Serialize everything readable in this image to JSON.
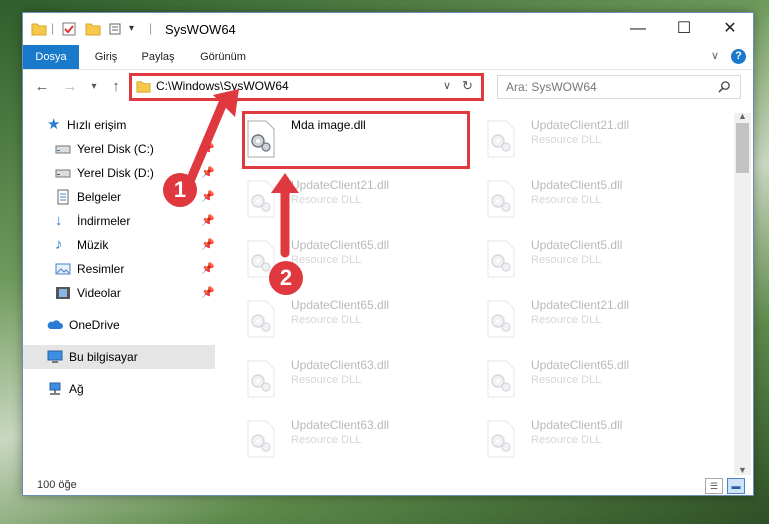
{
  "window": {
    "title": "SysWOW64",
    "minimize": "—",
    "maximize": "☐",
    "close": "✕"
  },
  "ribbon": {
    "tabs": [
      "Dosya",
      "Giriş",
      "Paylaş",
      "Görünüm"
    ]
  },
  "navbar": {
    "address": "C:\\Windows\\SysWOW64",
    "search_placeholder": "Ara: SysWOW64"
  },
  "sidebar": {
    "items": [
      {
        "label": "Hızlı erişim",
        "icon": "star-icon"
      },
      {
        "label": "Yerel Disk (C:)",
        "icon": "drive-icon"
      },
      {
        "label": "Yerel Disk (D:)",
        "icon": "drive-icon"
      },
      {
        "label": "Belgeler",
        "icon": "documents-icon"
      },
      {
        "label": "İndirmeler",
        "icon": "download-icon"
      },
      {
        "label": "Müzik",
        "icon": "music-icon"
      },
      {
        "label": "Resimler",
        "icon": "pictures-icon"
      },
      {
        "label": "Videolar",
        "icon": "videos-icon"
      },
      {
        "label": "OneDrive",
        "icon": "cloud-icon"
      },
      {
        "label": "Bu bilgisayar",
        "icon": "computer-icon"
      },
      {
        "label": "Ağ",
        "icon": "network-icon"
      }
    ]
  },
  "files": [
    {
      "name": "Mda image.dll",
      "type": ""
    },
    {
      "name": "UpdateClient21.dll",
      "type": "Resource DLL"
    },
    {
      "name": "UpdateClient21.dll",
      "type": "Resource DLL"
    },
    {
      "name": "UpdateClient5.dll",
      "type": "Resource DLL"
    },
    {
      "name": "UpdateClient65.dll",
      "type": "Resource DLL"
    },
    {
      "name": "UpdateClient5.dll",
      "type": "Resource DLL"
    },
    {
      "name": "UpdateClient65.dll",
      "type": "Resource DLL"
    },
    {
      "name": "UpdateClient21.dll",
      "type": "Resource DLL"
    },
    {
      "name": "UpdateClient63.dll",
      "type": "Resource DLL"
    },
    {
      "name": "UpdateClient65.dll",
      "type": "Resource DLL"
    },
    {
      "name": "UpdateClient63.dll",
      "type": "Resource DLL"
    },
    {
      "name": "UpdateClient5.dll",
      "type": "Resource DLL"
    }
  ],
  "status": {
    "count": "100 öğe"
  },
  "annotations": {
    "badge1": "1",
    "badge2": "2"
  },
  "colors": {
    "accent": "#1979ca",
    "highlight": "#e0383f",
    "selected_nav": "#e5e5e5"
  }
}
